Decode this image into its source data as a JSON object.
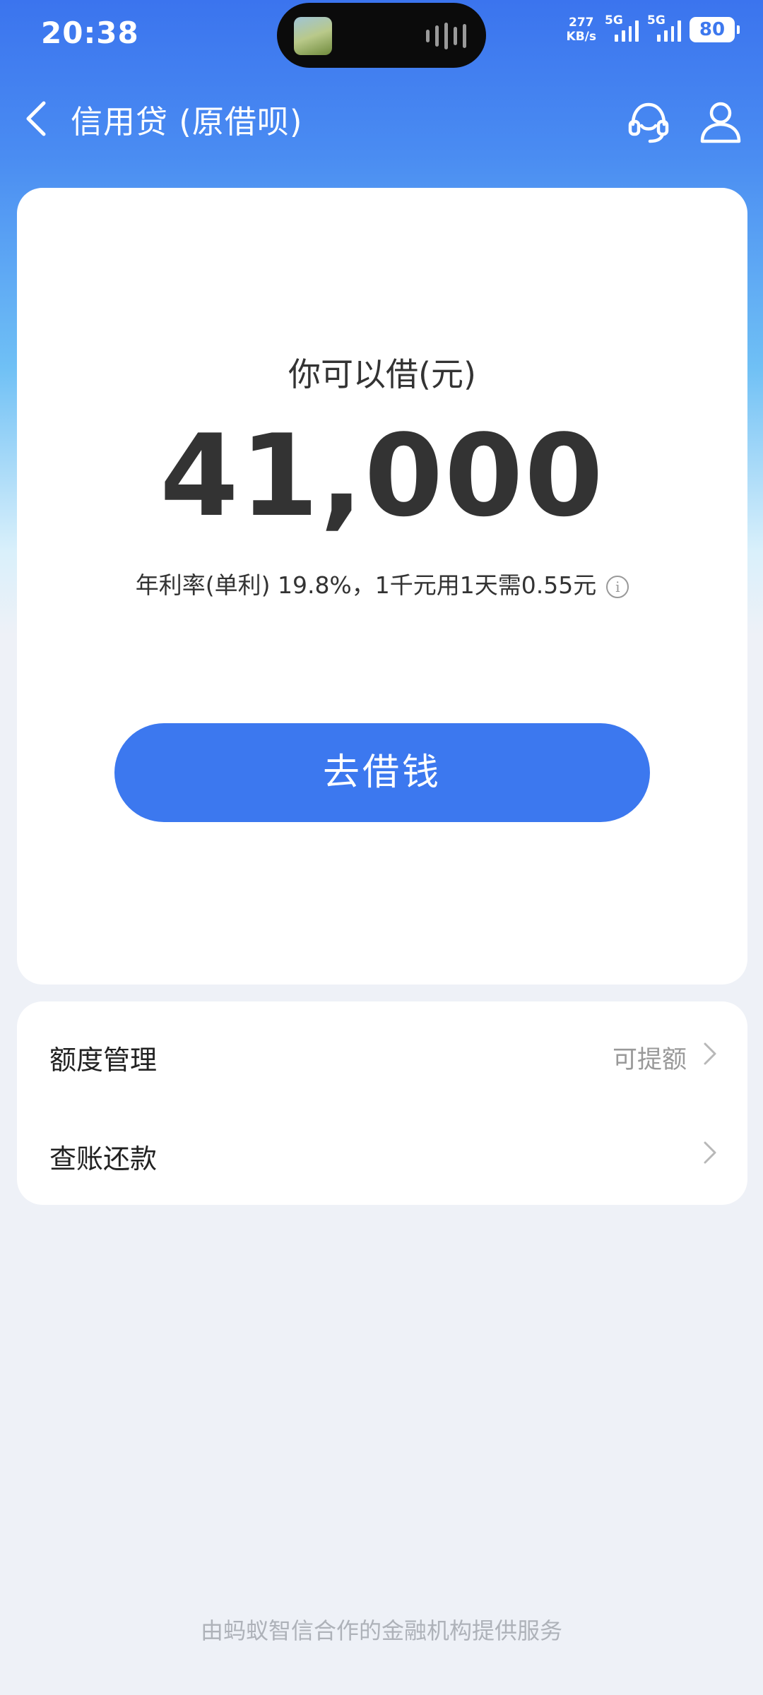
{
  "status_bar": {
    "time": "20:38",
    "net_speed_value": "277",
    "net_speed_unit": "KB/s",
    "signal1_tag": "5G",
    "signal2_tag": "5G",
    "battery": "80"
  },
  "nav": {
    "title": "信用贷 (原借呗)",
    "back_icon": "chevron-left-icon",
    "service_icon": "headset-icon",
    "user_icon": "user-icon"
  },
  "main": {
    "borrow_label": "你可以借(元)",
    "amount": "41,000",
    "rate_text": "年利率(单利) 19.8%，1千元用1天需0.55元",
    "info_icon": "i",
    "borrow_button": "去借钱"
  },
  "menu": {
    "items": [
      {
        "label": "额度管理",
        "sub": "可提额"
      },
      {
        "label": "查账还款",
        "sub": ""
      }
    ]
  },
  "footer": {
    "text": "由蚂蚁智信合作的金融机构提供服务"
  },
  "colors": {
    "accent": "#3c78ef",
    "header_gradient_top": "#3b74ee",
    "background": "#eef1f7"
  }
}
